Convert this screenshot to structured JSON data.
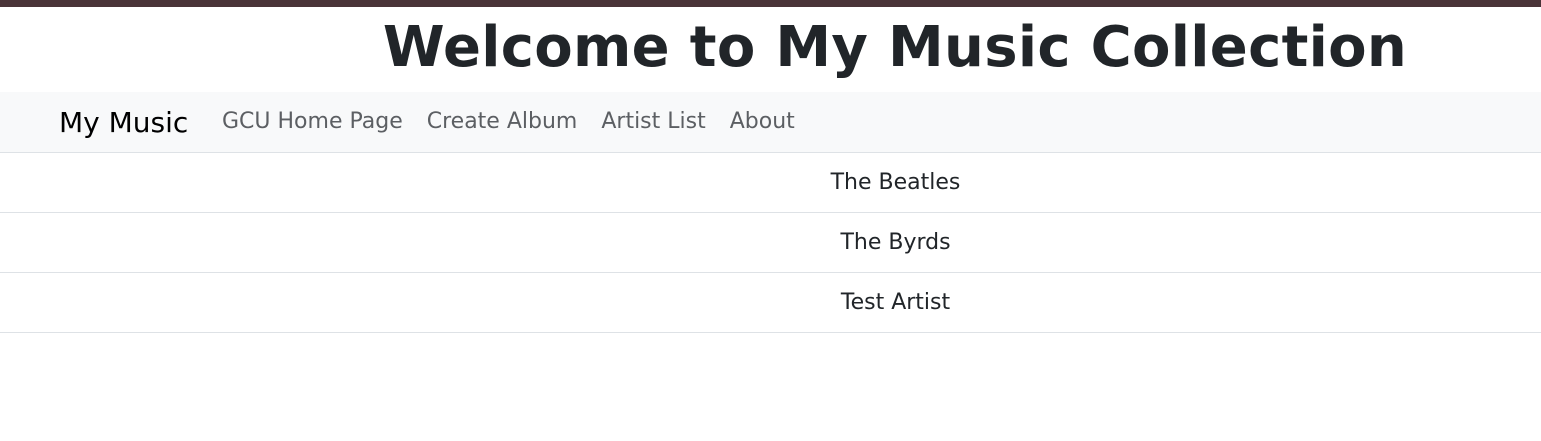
{
  "colors": {
    "top_strip": "#4a3438",
    "navbar_bg": "#f8f9fa",
    "text": "#212529",
    "nav_link": "#5c5f63",
    "divider": "#dee2e6"
  },
  "header": {
    "title": "Welcome to My Music Collection"
  },
  "navbar": {
    "brand": "My Music",
    "links": [
      {
        "label": "GCU Home Page"
      },
      {
        "label": "Create Album"
      },
      {
        "label": "Artist List"
      },
      {
        "label": "About"
      }
    ]
  },
  "artists": [
    {
      "name": "The Beatles"
    },
    {
      "name": "The Byrds"
    },
    {
      "name": "Test Artist"
    }
  ]
}
